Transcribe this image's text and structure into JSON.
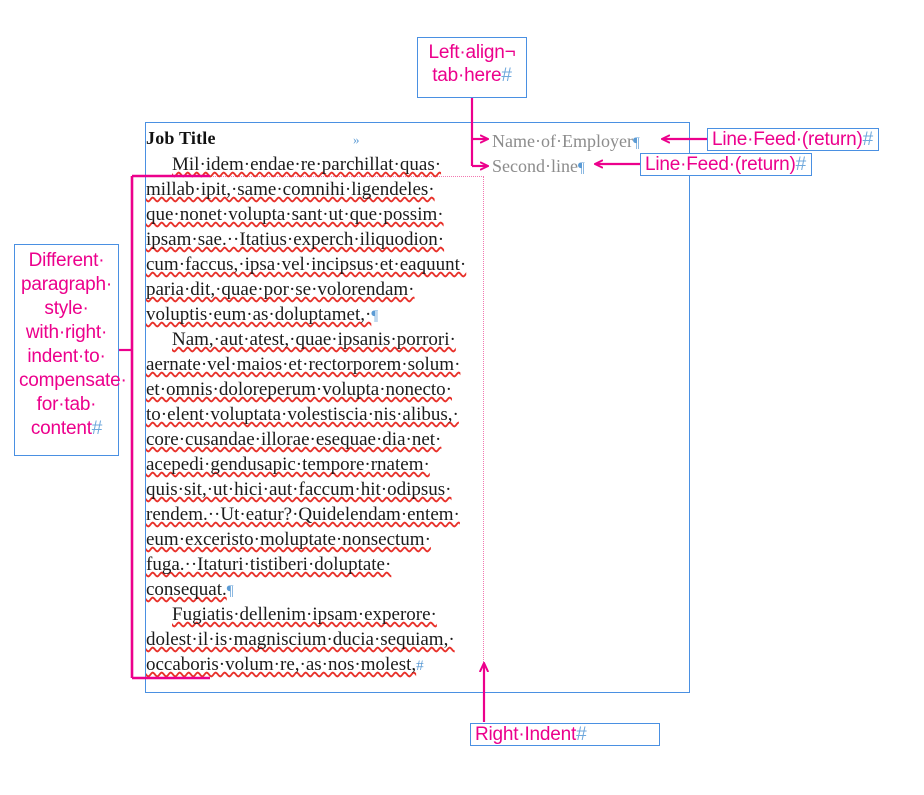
{
  "document": {
    "title": "Job Title",
    "tab_marker": "»",
    "employer": {
      "line1": "Name·of·Employer",
      "line2": "Second·line"
    },
    "paragraphs": [
      {
        "name": "paragraph-1",
        "lines": [
          "Mil·idem·endae·re·parchillat·quas·",
          "millab·ipit,·same·comnihi·ligendeles·",
          "que·nonet·volupta·sant·ut·que·possim·",
          "ipsam·sae.··Itatius·experch·iliquodion·",
          "cum·faccus,·ipsa·vel·incipsus·et·eaquunt·",
          "paria·dit,·quae·por·se·volorendam·",
          "voluptis·eum·as·doluptamet,·"
        ]
      },
      {
        "name": "paragraph-2",
        "lines": [
          "Nam,·aut·atest,·quae·ipsanis·porrori·",
          "aernate·vel·maios·et·rectorporem·solum·",
          "et·omnis·doloreperum·volupta·nonecto·",
          "to·elent·voluptata·volestiscia·nis·alibus,·",
          "core·cusandae·illorae·esequae·dia·net·",
          "acepedi·gendusapic·tempore·rnatem·",
          "quis·sit,·ut·hici·aut·faccum·hit·odipsus·",
          "rendem.··Ut·eatur?·Quidelendam·entem·",
          "eum·exceristo·moluptate·nonsectum·",
          "fuga.··Itaturi·tistiberi·doluptate·",
          "consequat."
        ]
      },
      {
        "name": "paragraph-3",
        "lines": [
          "Fugiatis·dellenim·ipsam·experore·",
          "dolest·il·is·magniscium·ducia·sequiam,·",
          "occaboris·volum·re,·as·nos·molest,"
        ]
      }
    ],
    "marks": {
      "pilcrow": "¶",
      "end_of_story": "#"
    }
  },
  "annotations": {
    "left_align_tab": {
      "line1": "Left·align¬",
      "line2": "tab·here",
      "hash": "#"
    },
    "paragraph_style": {
      "lines": [
        "Different·",
        "paragraph·",
        "style·",
        "with·right·",
        "indent·to·",
        "compensate·",
        "for·tab·",
        "content"
      ],
      "hash": "#"
    },
    "line_feed_1": {
      "text": "Line·Feed·(return)",
      "hash": "#"
    },
    "line_feed_2": {
      "text": "Line·Feed·(return)",
      "hash": "#"
    },
    "right_indent": {
      "text": "Right·Indent",
      "hash": "#"
    }
  },
  "colors": {
    "annotation": "#ec008c",
    "callout_border": "#4a90e2",
    "doc_border": "#4a90e2",
    "guide": "#f277b0",
    "spellcheck": "#e8312a",
    "mark_blue": "#5b9bd5",
    "grey_text": "#8c8c8c"
  }
}
